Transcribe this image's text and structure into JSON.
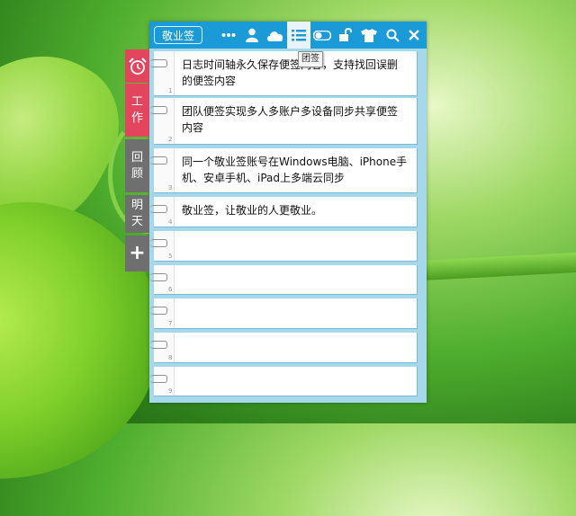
{
  "toolbar": {
    "brand": "敬业签",
    "icons": [
      "more-icon",
      "user-icon",
      "cloud-icon",
      "list-icon",
      "toggle-icon",
      "unlock-icon",
      "shirt-icon",
      "search-icon",
      "close-icon"
    ],
    "tooltip": "团签"
  },
  "side_tabs": {
    "work": [
      "工",
      "作"
    ],
    "review": [
      "回",
      "顾"
    ],
    "tomorrow": [
      "明",
      "天"
    ],
    "add": "+"
  },
  "notes": [
    {
      "num": "1",
      "text": "日志时间轴永久保存便签内容，支持找回误删的便签内容"
    },
    {
      "num": "2",
      "text": "团队便签实现多人多账户多设备同步共享便签内容"
    },
    {
      "num": "3",
      "text": "同一个敬业签账号在Windows电脑、iPhone手机、安卓手机、iPad上多端云同步"
    },
    {
      "num": "4",
      "text": "敬业签，让敬业的人更敬业。"
    },
    {
      "num": "5",
      "text": ""
    },
    {
      "num": "6",
      "text": ""
    },
    {
      "num": "7",
      "text": ""
    },
    {
      "num": "8",
      "text": ""
    },
    {
      "num": "9",
      "text": ""
    }
  ],
  "colors": {
    "toolbar": "#1b9ad8",
    "accent_red": "#e2465f",
    "tab_gray": "#6f6f6f",
    "panel_bg": "#a6d8ec"
  }
}
